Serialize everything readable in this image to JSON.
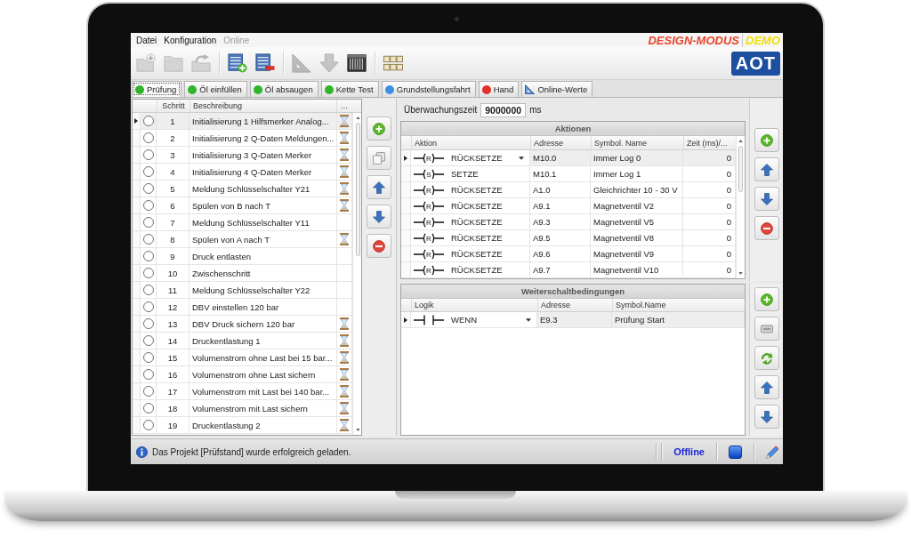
{
  "menu": {
    "items": [
      {
        "label": "Datei",
        "disabled": false
      },
      {
        "label": "Konfiguration",
        "disabled": false
      },
      {
        "label": "Online",
        "disabled": true
      }
    ],
    "mode": "DESIGN-MODUS",
    "edition": "DEMO"
  },
  "toolbar": {
    "groups": [
      [
        {
          "kind": "new",
          "disabled": true
        },
        {
          "kind": "open",
          "disabled": true
        },
        {
          "kind": "import",
          "disabled": true
        }
      ],
      [
        {
          "kind": "add-step",
          "disabled": false
        },
        {
          "kind": "remove-step",
          "disabled": false
        }
      ],
      [
        {
          "kind": "set-square",
          "disabled": true
        },
        {
          "kind": "download",
          "disabled": true
        },
        {
          "kind": "module",
          "disabled": false
        }
      ],
      [
        {
          "kind": "keypad",
          "disabled": false
        }
      ]
    ],
    "logo": "AOT"
  },
  "tabs": [
    {
      "label": "Prüfung",
      "selected": true,
      "kind": "dot",
      "color": "#2fb52a"
    },
    {
      "label": "Öl einfüllen",
      "selected": false,
      "kind": "dot",
      "color": "#2fb52a"
    },
    {
      "label": "Öl absaugen",
      "selected": false,
      "kind": "dot",
      "color": "#2fb52a"
    },
    {
      "label": "Kette Test",
      "selected": false,
      "kind": "dot",
      "color": "#2fb52a"
    },
    {
      "label": "Grundstellungsfahrt",
      "selected": false,
      "kind": "dot",
      "color": "#3f8fe0"
    },
    {
      "label": "Hand",
      "selected": false,
      "kind": "dot",
      "color": "#e2302a"
    },
    {
      "label": "Online-Werte",
      "selected": false,
      "kind": "triangle"
    }
  ],
  "steps": {
    "columns": [
      "Schritt",
      "Beschreibung",
      "..."
    ],
    "rows": [
      {
        "number": "1",
        "text": "Initialisierung 1 Hilfsmerker Analog...",
        "timer": true,
        "checked": false,
        "selected": true
      },
      {
        "number": "2",
        "text": "Initialisierung 2 Q-Daten Meldungen...",
        "timer": true,
        "checked": false,
        "selected": false
      },
      {
        "number": "3",
        "text": "Initialisierung 3 Q-Daten Merker",
        "timer": true,
        "checked": false,
        "selected": false
      },
      {
        "number": "4",
        "text": "Initialisierung 4 Q-Daten Merker",
        "timer": true,
        "checked": false,
        "selected": false
      },
      {
        "number": "5",
        "text": "Meldung Schlüsselschalter Y21",
        "timer": true,
        "checked": false,
        "selected": false
      },
      {
        "number": "6",
        "text": "Spülen von B nach T",
        "timer": true,
        "checked": false,
        "selected": false
      },
      {
        "number": "7",
        "text": "Meldung Schlüsselschalter Y11",
        "timer": false,
        "checked": false,
        "selected": false
      },
      {
        "number": "8",
        "text": "Spülen von A nach T",
        "timer": true,
        "checked": false,
        "selected": false
      },
      {
        "number": "9",
        "text": "Druck entlasten",
        "timer": false,
        "checked": false,
        "selected": false
      },
      {
        "number": "10",
        "text": "Zwischenschritt",
        "timer": false,
        "checked": false,
        "selected": false
      },
      {
        "number": "11",
        "text": "Meldung Schlüsselschalter Y22",
        "timer": false,
        "checked": false,
        "selected": false
      },
      {
        "number": "12",
        "text": "DBV einstellen 120 bar",
        "timer": false,
        "checked": false,
        "selected": false
      },
      {
        "number": "13",
        "text": "DBV Druck sichern 120 bar",
        "timer": true,
        "checked": false,
        "selected": false
      },
      {
        "number": "14",
        "text": "Druckentlastung 1",
        "timer": true,
        "checked": false,
        "selected": false
      },
      {
        "number": "15",
        "text": "Volumenstrom ohne Last bei 15 bar...",
        "timer": true,
        "checked": false,
        "selected": false
      },
      {
        "number": "16",
        "text": "Volumenstrom ohne Last sichern",
        "timer": true,
        "checked": false,
        "selected": false
      },
      {
        "number": "17",
        "text": "Volumenstrom mit Last bei 140 bar...",
        "timer": true,
        "checked": false,
        "selected": false
      },
      {
        "number": "18",
        "text": "Volumenstrom mit Last sichern",
        "timer": true,
        "checked": false,
        "selected": false
      },
      {
        "number": "19",
        "text": "Druckentlastung 2",
        "timer": true,
        "checked": false,
        "selected": false
      }
    ]
  },
  "step_buttons": [
    {
      "kind": "add"
    },
    {
      "kind": "copy"
    },
    {
      "kind": "up"
    },
    {
      "kind": "down"
    },
    {
      "kind": "remove"
    }
  ],
  "monitoring": {
    "label": "Überwachungszeit",
    "value": "9000000",
    "unit": "ms"
  },
  "actions": {
    "title": "Aktionen",
    "columns": [
      "Aktion",
      "Adresse",
      "Symbol. Name",
      "Zeit (ms)/..."
    ],
    "rows": [
      {
        "coil": "R",
        "action": "RÜCKSETZE",
        "address": "M10.0",
        "symbol": "Immer Log 0",
        "time": "0",
        "selected": true
      },
      {
        "coil": "S",
        "action": "SETZE",
        "address": "M10.1",
        "symbol": "Immer Log 1",
        "time": "0",
        "selected": false
      },
      {
        "coil": "R",
        "action": "RÜCKSETZE",
        "address": "A1.0",
        "symbol": "Gleichrichter 10 - 30 V",
        "time": "0",
        "selected": false
      },
      {
        "coil": "R",
        "action": "RÜCKSETZE",
        "address": "A9.1",
        "symbol": "Magnetventil V2",
        "time": "0",
        "selected": false
      },
      {
        "coil": "R",
        "action": "RÜCKSETZE",
        "address": "A9.3",
        "symbol": "Magnetventil V5",
        "time": "0",
        "selected": false
      },
      {
        "coil": "R",
        "action": "RÜCKSETZE",
        "address": "A9.5",
        "symbol": "Magnetventil V8",
        "time": "0",
        "selected": false
      },
      {
        "coil": "R",
        "action": "RÜCKSETZE",
        "address": "A9.6",
        "symbol": "Magnetventil V9",
        "time": "0",
        "selected": false
      },
      {
        "coil": "R",
        "action": "RÜCKSETZE",
        "address": "A9.7",
        "symbol": "Magnetventil V10",
        "time": "0",
        "selected": false
      }
    ],
    "buttons": [
      {
        "kind": "add"
      },
      {
        "kind": "up"
      },
      {
        "kind": "down"
      },
      {
        "kind": "remove"
      }
    ]
  },
  "conditions": {
    "title": "Weiterschaltbedingungen",
    "columns": [
      "Logik",
      "Adresse",
      "Symbol.Name"
    ],
    "rows": [
      {
        "logic": "WENN",
        "address": "E9.3",
        "symbol": "Prüfung Start",
        "selected": true
      }
    ],
    "buttons": [
      {
        "kind": "add"
      },
      {
        "kind": "field"
      },
      {
        "kind": "refresh"
      },
      {
        "kind": "up"
      },
      {
        "kind": "down"
      }
    ]
  },
  "status_bar": {
    "message": "Das Projekt [Prüfstand] wurde erfolgreich geladen.",
    "connection": "Offline"
  }
}
